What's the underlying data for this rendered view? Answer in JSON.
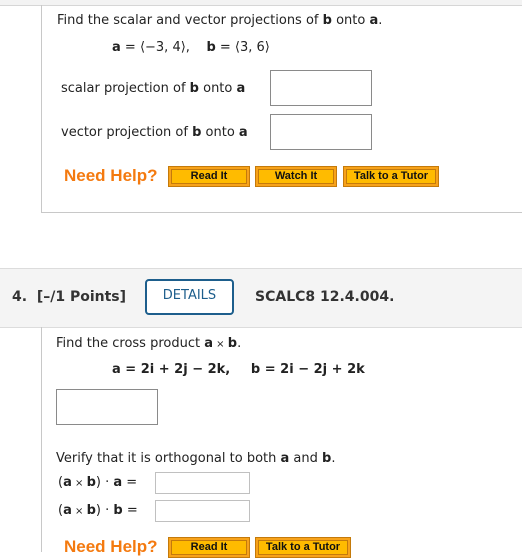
{
  "question3": {
    "prompt_pre": "Find the scalar and vector projections of ",
    "prompt_b": "b",
    "prompt_mid": " onto ",
    "prompt_a": "a",
    "prompt_end": ".",
    "given": {
      "a_label": "a",
      "a_value": " = ⟨−3, 4⟩,",
      "b_label": "b",
      "b_value": " = ⟨3, 6⟩"
    },
    "fields": [
      {
        "pre": "scalar projection of ",
        "b": "b",
        "mid": " onto ",
        "a": "a",
        "value": ""
      },
      {
        "pre": "vector projection of ",
        "b": "b",
        "mid": " onto ",
        "a": "a",
        "value": ""
      }
    ],
    "help": {
      "label": "Need Help?",
      "buttons": [
        "Read It",
        "Watch It",
        "Talk to a Tutor"
      ]
    }
  },
  "question4": {
    "number": "4.",
    "points": "[–/1 Points]",
    "details_label": "DETAILS",
    "code": "SCALC8 12.4.004.",
    "prompt_pre": "Find the cross product ",
    "prompt_a": "a",
    "prompt_x": " × ",
    "prompt_b": "b",
    "prompt_end": ".",
    "given": {
      "a_label": "a",
      "a_value": " = 2i + 2j − 2k,",
      "b_label": "b",
      "b_value": " = 2i − 2j + 2k"
    },
    "cross_answer": "",
    "verify_pre": "Verify that it is orthogonal to both ",
    "verify_a": "a",
    "verify_mid": " and ",
    "verify_b": "b",
    "verify_end": ".",
    "dot_rows": [
      {
        "label_open": "(",
        "a": "a",
        "x": " × ",
        "b": "b",
        "close": ") · ",
        "target": "a",
        "eq": " =",
        "value": ""
      },
      {
        "label_open": "(",
        "a": "a",
        "x": " × ",
        "b": "b",
        "close": ") · ",
        "target": "b",
        "eq": " =",
        "value": ""
      }
    ],
    "help": {
      "label": "Need Help?",
      "buttons": [
        "Read It",
        "Talk to a Tutor"
      ]
    }
  }
}
